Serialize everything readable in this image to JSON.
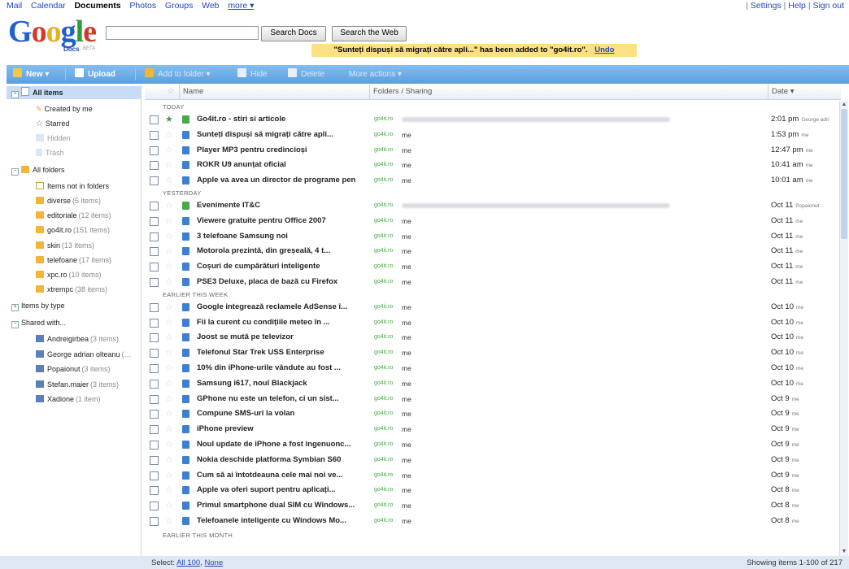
{
  "topnav": {
    "links": [
      "Mail",
      "Calendar",
      "Documents",
      "Photos",
      "Groups",
      "Web",
      "more ▾"
    ],
    "selected_index": 2,
    "right": [
      "Settings",
      "Help",
      "Sign out"
    ]
  },
  "logo": {
    "word": "Google",
    "sub": "Docs",
    "beta": "BETA"
  },
  "search": {
    "value": "",
    "search_docs": "Search Docs",
    "search_web": "Search the Web"
  },
  "notice": {
    "text": "\"Sunteți dispuși să migrați către apli...\" has been added to \"go4it.ro\".",
    "undo": "Undo"
  },
  "toolbar": {
    "new": "New ▾",
    "upload": "Upload",
    "add_to_folder": "Add to folder ▾",
    "hide": "Hide",
    "delete": "Delete",
    "more_actions": "More actions ▾"
  },
  "sidebar": {
    "all_items": "All items",
    "created_by_me": "Created by me",
    "starred": "Starred",
    "hidden": "Hidden",
    "trash": "Trash",
    "all_folders": "All folders",
    "items_not_in_folders": "Items not in folders",
    "folders": [
      {
        "name": "diverse",
        "count": "(5 items)"
      },
      {
        "name": "editoriale",
        "count": "(12 items)"
      },
      {
        "name": "go4it.ro",
        "count": "(151 items)"
      },
      {
        "name": "skin",
        "count": "(13 items)"
      },
      {
        "name": "telefoane",
        "count": "(17 items)"
      },
      {
        "name": "xpc.ro",
        "count": "(10 items)"
      },
      {
        "name": "xtrempc",
        "count": "(38 items)"
      }
    ],
    "items_by_type": "Items by type",
    "shared_with": "Shared with...",
    "people": [
      {
        "name": "Andreigirbea",
        "count": "(3 items)"
      },
      {
        "name": "George adrian olteanu",
        "count": "(…"
      },
      {
        "name": "Popaionut",
        "count": "(3 items)"
      },
      {
        "name": "Stefan.maier",
        "count": "(3 items)"
      },
      {
        "name": "Xadione",
        "count": "(1 item)"
      }
    ]
  },
  "list": {
    "headers": {
      "name": "Name",
      "folders_sharing": "Folders / Sharing",
      "date": "Date ▾"
    },
    "groups": [
      "TODAY",
      "YESTERDAY",
      "EARLIER THIS WEEK",
      "EARLIER THIS MONTH"
    ],
    "rows": [
      {
        "title": "Go4it.ro - stiri si articole",
        "shr": "go4it.ro",
        "who": "",
        "date": "2:01 pm",
        "by": "George adri",
        "starred": true,
        "sheet": true
      },
      {
        "title": "Sunteți dispuși să migrați către apli...",
        "shr": "go4it.ro",
        "who": "me",
        "date": "1:53 pm",
        "by": "me"
      },
      {
        "title": "Player MP3 pentru credincioși",
        "shr": "go4it.ro",
        "who": "me",
        "date": "12:47 pm",
        "by": "me"
      },
      {
        "title": "ROKR U9 anunțat oficial",
        "shr": "go4it.ro",
        "who": "me",
        "date": "10:41 am",
        "by": "me"
      },
      {
        "title": "Apple va avea un director de programe pen",
        "shr": "go4it.ro",
        "who": "me",
        "date": "10:01 am",
        "by": "me"
      },
      {
        "title": "Evenimente IT&C",
        "shr": "go4it.ro",
        "who": "",
        "date": "Oct 11",
        "by": "Popaionut",
        "sheet": true
      },
      {
        "title": "Viewere gratuite pentru Office 2007",
        "shr": "go4it.ro",
        "who": "me",
        "date": "Oct 11",
        "by": "me"
      },
      {
        "title": "3 telefoane Samsung noi",
        "shr": "go4it.ro",
        "who": "me",
        "date": "Oct 11",
        "by": "me"
      },
      {
        "title": "Motorola prezintă, din greșeală, 4 t...",
        "shr": "go4it.ro",
        "who": "me",
        "date": "Oct 11",
        "by": "me"
      },
      {
        "title": "Coșuri de cumpărături inteligente",
        "shr": "go4it.ro",
        "who": "me",
        "date": "Oct 11",
        "by": "me"
      },
      {
        "title": "PSE3 Deluxe, placa de bază cu Firefox",
        "shr": "go4it.ro",
        "who": "me",
        "date": "Oct 11",
        "by": "me"
      },
      {
        "title": "Google integrează reclamele AdSense î...",
        "shr": "go4it.ro",
        "who": "me",
        "date": "Oct 10",
        "by": "me"
      },
      {
        "title": "Fii la curent cu condițiile meteo în ...",
        "shr": "go4it.ro",
        "who": "me",
        "date": "Oct 10",
        "by": "me"
      },
      {
        "title": "Joost se mută pe televizor",
        "shr": "go4it.ro",
        "who": "me",
        "date": "Oct 10",
        "by": "me"
      },
      {
        "title": "Telefonul Star Trek USS Enterprise",
        "shr": "go4it.ro",
        "who": "me",
        "date": "Oct 10",
        "by": "me"
      },
      {
        "title": "10% din iPhone-urile vândute au fost ...",
        "shr": "go4it.ro",
        "who": "me",
        "date": "Oct 10",
        "by": "me"
      },
      {
        "title": "Samsung i617, noul Blackjack",
        "shr": "go4it.ro",
        "who": "me",
        "date": "Oct 10",
        "by": "me"
      },
      {
        "title": "GPhone nu este un telefon, ci un sist...",
        "shr": "go4it.ro",
        "who": "me",
        "date": "Oct 9",
        "by": "me"
      },
      {
        "title": "Compune SMS-uri la volan",
        "shr": "go4it.ro",
        "who": "me",
        "date": "Oct 9",
        "by": "me"
      },
      {
        "title": "iPhone preview",
        "shr": "go4it.ro",
        "who": "me",
        "date": "Oct 9",
        "by": "me"
      },
      {
        "title": "Noul update de iPhone a fost ingenuonc...",
        "shr": "go4it.ro",
        "who": "me",
        "date": "Oct 9",
        "by": "me"
      },
      {
        "title": "Nokia deschide platforma Symbian S60",
        "shr": "go4it.ro",
        "who": "me",
        "date": "Oct 9",
        "by": "me"
      },
      {
        "title": "Cum să ai întotdeauna cele mai noi ve...",
        "shr": "go4it.ro",
        "who": "me",
        "date": "Oct 9",
        "by": "me"
      },
      {
        "title": "Apple va oferi suport pentru aplicați...",
        "shr": "go4it.ro",
        "who": "me",
        "date": "Oct 8",
        "by": "me"
      },
      {
        "title": "Primul smartphone dual SIM cu Windows...",
        "shr": "go4it.ro",
        "who": "me",
        "date": "Oct 8",
        "by": "me"
      },
      {
        "title": "Telefoanele inteligente cu Windows Mo...",
        "shr": "go4it.ro",
        "who": "me",
        "date": "Oct 8",
        "by": "me"
      }
    ]
  },
  "footer": {
    "select_label": "Select:",
    "select_all": "All 100",
    "select_none": "None",
    "showing": "Showing items 1-100 of 217"
  },
  "colors": {
    "toolbar": "#5a9fe0",
    "notice": "#fbe184",
    "link": "#2446b8",
    "google_blue": "#1f5fd0",
    "google_red": "#d03a2a",
    "google_yellow": "#e8b020",
    "google_green": "#2f9a3a"
  }
}
